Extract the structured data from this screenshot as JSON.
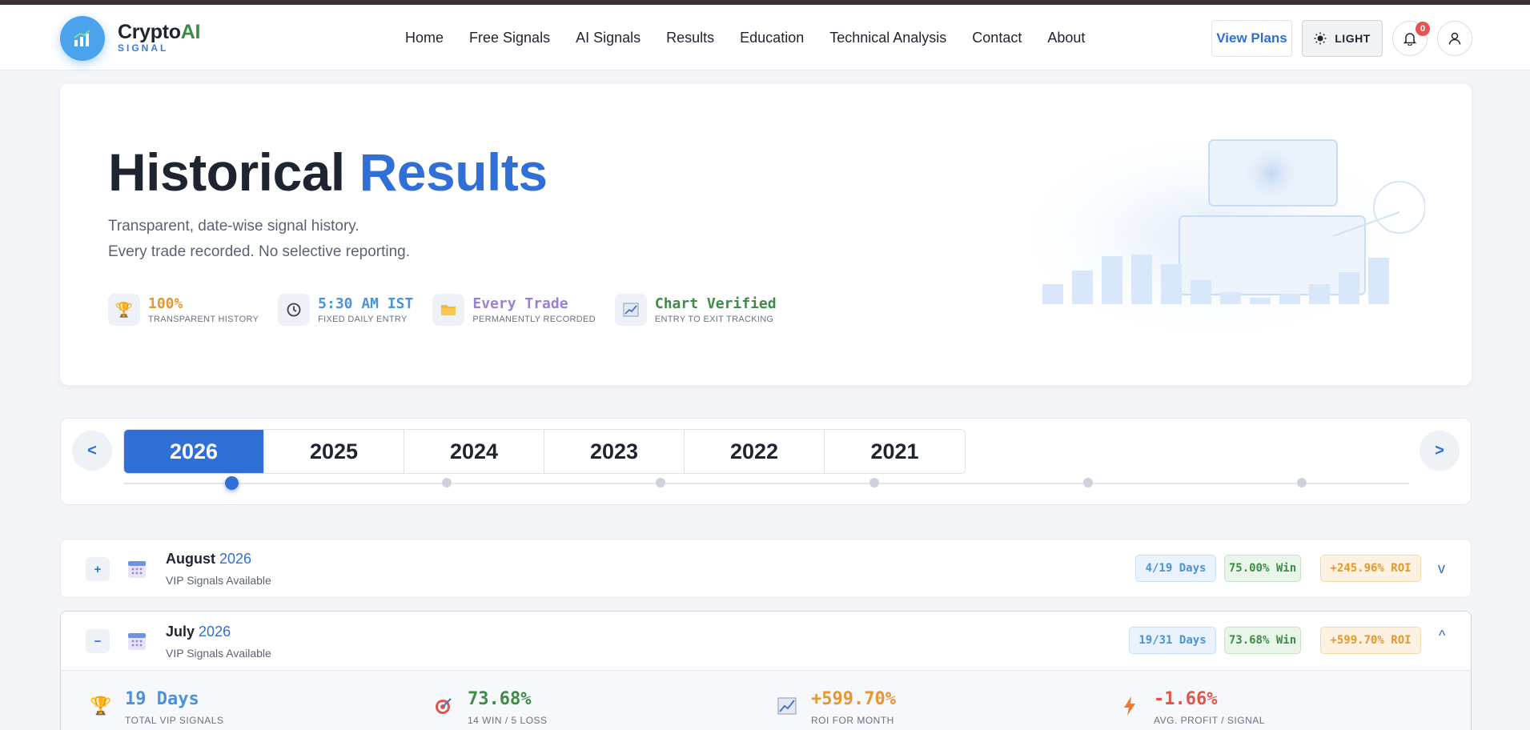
{
  "brand": {
    "name_main": "Crypto",
    "name_accent": "AI",
    "tagline": "SIGNAL"
  },
  "nav": [
    "Home",
    "Free Signals",
    "AI Signals",
    "Results",
    "Education",
    "Technical Analysis",
    "Contact",
    "About"
  ],
  "header": {
    "plans_label": "View Plans",
    "theme_label": "LIGHT",
    "notification_count": "0"
  },
  "hero": {
    "title_main": "Historical",
    "title_accent": "Results",
    "subtitle_line1": "Transparent, date-wise signal history.",
    "subtitle_line2": "Every trade recorded. No selective reporting.",
    "stats": [
      {
        "icon": "trophy-icon",
        "value": "100%",
        "label": "TRANSPARENT HISTORY",
        "color": "#e8962b"
      },
      {
        "icon": "clock-icon",
        "value": "5:30 AM IST",
        "label": "FIXED DAILY ENTRY",
        "color": "#4b92d8"
      },
      {
        "icon": "folder-icon",
        "value": "Every Trade",
        "label": "PERMANENTLY RECORDED",
        "color": "#9b7fd4"
      },
      {
        "icon": "chart-icon",
        "value": "Chart Verified",
        "label": "ENTRY TO EXIT TRACKING",
        "color": "#3d8b46"
      }
    ]
  },
  "years": {
    "prev_label": "<",
    "next_label": ">",
    "items": [
      "2026",
      "2025",
      "2024",
      "2023",
      "2022",
      "2021"
    ],
    "active": "2026"
  },
  "months": [
    {
      "toggle": "+",
      "name": "August",
      "year": "2026",
      "sub": "VIP Signals Available",
      "days": "4/19 Days",
      "win": "75.00% Win",
      "roi": "+245.96% ROI",
      "chevron": "v"
    },
    {
      "toggle": "−",
      "name": "July",
      "year": "2026",
      "sub": "VIP Signals Available",
      "days": "19/31 Days",
      "win": "73.68% Win",
      "roi": "+599.70% ROI",
      "chevron": "^"
    }
  ],
  "july_details": [
    {
      "icon": "trophy-icon",
      "value": "19 Days",
      "label": "TOTAL VIP SIGNALS",
      "color": "#4b92d8"
    },
    {
      "icon": "target-icon",
      "value": "73.68%",
      "label": "14 WIN / 5 LOSS",
      "color": "#3d8b46"
    },
    {
      "icon": "chart-icon",
      "value": "+599.70%",
      "label": "ROI FOR MONTH",
      "color": "#e8962b"
    },
    {
      "icon": "bolt-icon",
      "value": "-1.66%",
      "label": "AVG. PROFIT / SIGNAL",
      "color": "#e25548"
    }
  ]
}
